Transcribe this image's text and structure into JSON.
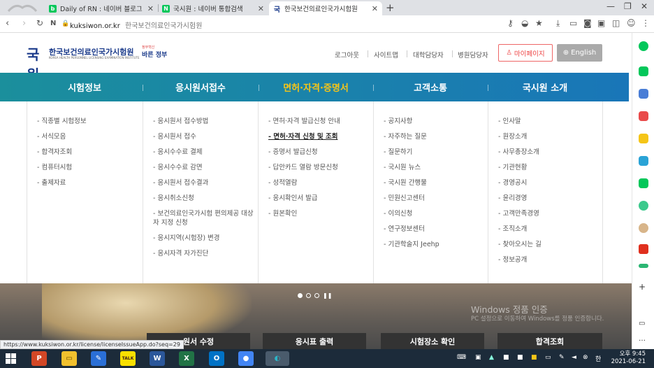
{
  "browser": {
    "tabs": [
      {
        "title": "Daily of RN : 네이버 블로그",
        "fav_color": "#03c75a",
        "fav_text": "b"
      },
      {
        "title": "국시원 : 네이버 통합검색",
        "fav_color": "#03c75a",
        "fav_text": "N"
      },
      {
        "title": "한국보건의료인국가시험원",
        "fav_color": "#1a3a8a",
        "fav_text": "국"
      }
    ],
    "url_domain": "kuksiwon.or.kr",
    "url_title": "한국보건의료인국가시험원",
    "new_tab": "+"
  },
  "site": {
    "logo_mark": "국원",
    "logo_name": "한국보건의료인국가시험원",
    "logo_sub": "KOREA HEALTH PERSONNEL LICENSING EXAMINATION INSTITUTE",
    "gov_top": "정부혁신",
    "gov_main": "바른 정부",
    "util": [
      "로그아웃",
      "사이트맵",
      "대학담당자",
      "병원담당자"
    ],
    "mypage": "마이페이지",
    "english": "English"
  },
  "gnb": [
    "시험정보",
    "응시원서접수",
    "면허·자격·증명서",
    "고객소통",
    "국시원 소개"
  ],
  "mega": [
    [
      "직종별 시험정보",
      "서식모음",
      "합격자조회",
      "컴퓨터시험",
      "출제자료"
    ],
    [
      "응시원서 접수방법",
      "응시원서 접수",
      "응시수수료 결제",
      "응시수수료 감면",
      "응시원서 접수결과",
      "응시취소신청",
      "보건의료인국가시험 편의제공 대상자 지정 신청",
      "응시지역(시험장) 변경",
      "응시자격 자가진단"
    ],
    [
      "면허·자격 발급신청 안내",
      "면허·자격 신청 및 조회",
      "증명서 발급신청",
      "답안카드 열람 방문신청",
      "성적열람",
      "응시확인서 발급",
      "원본확인"
    ],
    [
      "공지사항",
      "자주하는 질문",
      "질문하기",
      "국시원 뉴스",
      "국시원 간행물",
      "민원신고센터",
      "이의신청",
      "연구정보센터",
      "기관학술지 Jeehp"
    ],
    [
      "인사말",
      "원장소개",
      "사무총장소개",
      "기관현황",
      "경영공시",
      "윤리경영",
      "고객만족경영",
      "조직소개",
      "찾아오시는 길",
      "정보공개"
    ]
  ],
  "hero": {
    "quick": [
      "원서 수정",
      "응시표 출력",
      "시험장소 확인",
      "합격조회"
    ],
    "watermark1": "Windows 정품 인증",
    "watermark2": "PC 설정으로 이동하여 Windows를 정품 인증합니다."
  },
  "status_url": "https://www.kuksiwon.or.kr/license/licenseIssueApp.do?seq=29",
  "taskbar": {
    "time": "오후 9:45",
    "date": "2021-06-21",
    "apps": [
      {
        "name": "powerpoint",
        "color": "#d24726",
        "text": "P"
      },
      {
        "name": "explorer",
        "color": "#f2c12e",
        "text": "▭"
      },
      {
        "name": "paint",
        "color": "#2a6fd6",
        "text": "✎"
      },
      {
        "name": "kakaotalk",
        "color": "#f9e000",
        "text": "TALK"
      },
      {
        "name": "word",
        "color": "#2b579a",
        "text": "W"
      },
      {
        "name": "excel",
        "color": "#217346",
        "text": "X"
      },
      {
        "name": "outlook",
        "color": "#0072c6",
        "text": "O"
      },
      {
        "name": "chrome",
        "color": "#4285f4",
        "text": "●"
      },
      {
        "name": "whale",
        "color": "#2bb6c9",
        "text": "◐"
      }
    ]
  }
}
